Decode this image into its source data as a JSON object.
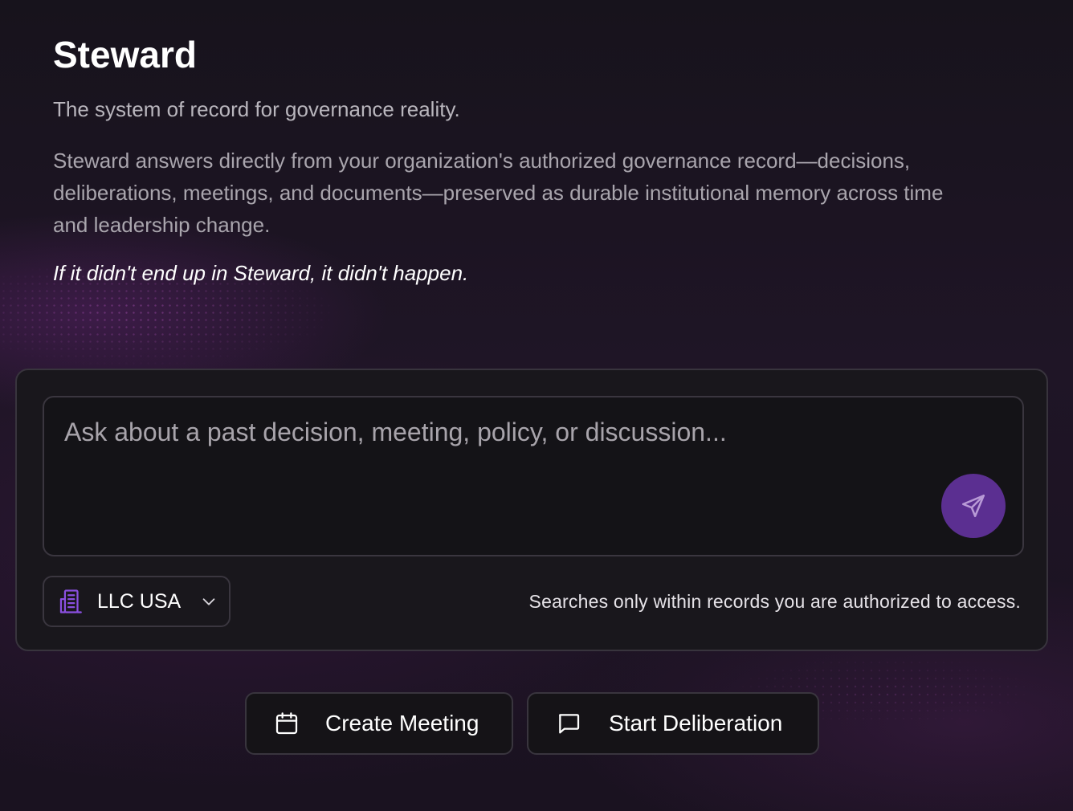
{
  "app": {
    "title": "Steward",
    "subtitle": "The system of record for governance reality.",
    "description": "Steward answers directly from your organization's authorized governance record—decisions, deliberations, meetings, and documents—preserved as durable institutional memory across time and leadership change.",
    "tagline": "If it didn't end up in Steward, it didn't happen."
  },
  "query": {
    "placeholder": "Ask about a past decision, meeting, policy, or discussion...",
    "value": "",
    "send_icon": "send-icon"
  },
  "organization": {
    "selected": "LLC USA",
    "icon": "building-icon",
    "dropdown_icon": "chevron-down-icon"
  },
  "auth_note": "Searches only within records you are authorized to access.",
  "actions": [
    {
      "label": "Create Meeting",
      "icon": "calendar-icon"
    },
    {
      "label": "Start Deliberation",
      "icon": "message-square-icon"
    }
  ],
  "colors": {
    "accent": "#5b2f91",
    "accent_icon": "#8a4fe0",
    "background": "#1a1520",
    "panel": "#19171c"
  }
}
